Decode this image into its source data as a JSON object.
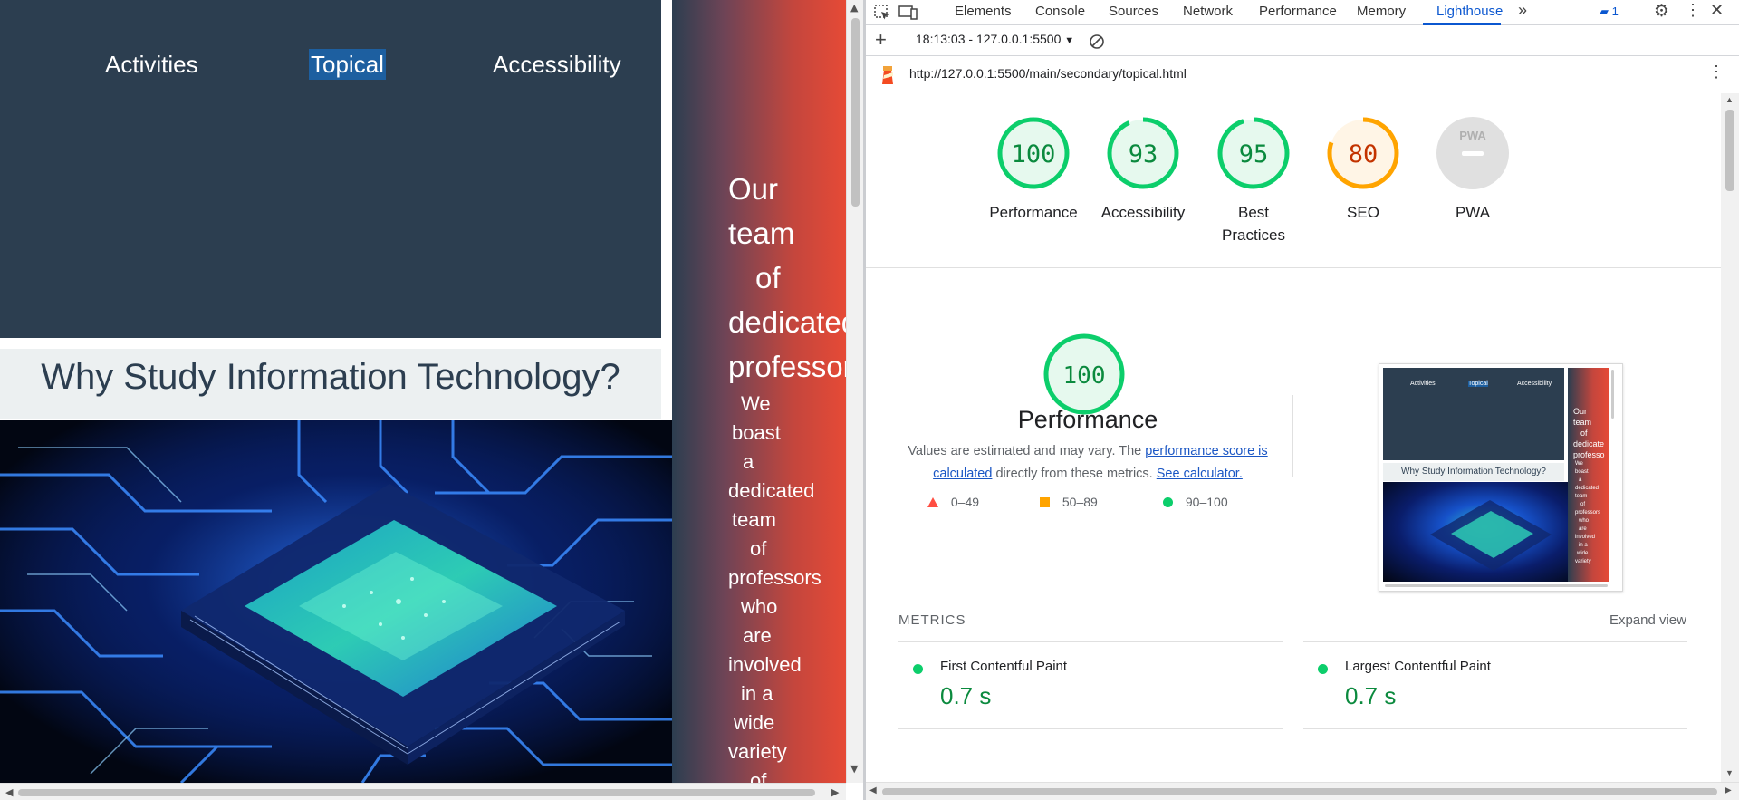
{
  "webpage": {
    "nav": {
      "activities": "Activities",
      "topical": "Topical",
      "accessibility": "Accessibility"
    },
    "heading": "Why Study Information Technology?",
    "side_big_words": [
      "Our",
      "team",
      "of",
      "dedicated",
      "professors"
    ],
    "side_small_words": [
      "We",
      "boast",
      "a",
      "dedicated",
      "team",
      "of",
      "professors",
      "who",
      "are",
      "involved",
      "in a",
      "wide",
      "variety",
      "of"
    ]
  },
  "devtools": {
    "tabs": [
      "Elements",
      "Console",
      "Sources",
      "Network",
      "Performance",
      "Memory",
      "Lighthouse"
    ],
    "active_tab": "Lighthouse",
    "issues_count": "1",
    "toolbar": {
      "add_label": "+",
      "report_select": "18:13:03 - 127.0.0.1:5500"
    },
    "url": "http://127.0.0.1:5500/main/secondary/topical.html",
    "colors": {
      "pass": "#0cce6b",
      "pass_text": "#0b8a3e",
      "average": "#ffa400",
      "average_text": "#c33300",
      "fail": "#ff4e42",
      "accent": "#0b57d0"
    },
    "gauges": [
      {
        "label": "Performance",
        "score": "100",
        "value": 100,
        "status": "pass"
      },
      {
        "label": "Accessibility",
        "score": "93",
        "value": 93,
        "status": "pass"
      },
      {
        "label": "Best Practices",
        "score": "95",
        "value": 95,
        "status": "pass"
      },
      {
        "label": "SEO",
        "score": "80",
        "value": 80,
        "status": "average"
      },
      {
        "label": "PWA",
        "badge": "PWA",
        "status": "na"
      }
    ],
    "performance": {
      "score": "100",
      "title": "Performance",
      "desc_before": "Values are estimated and may vary. The ",
      "desc_link": "performance score is calculated",
      "desc_middle": " directly from these metrics. ",
      "desc_link2": "See calculator.",
      "legend": [
        "0–49",
        "50–89",
        "90–100"
      ]
    },
    "thumbnail": {
      "nav": [
        "Activities",
        "Topical",
        "Accessibility"
      ],
      "heading": "Why Study Information Technology?",
      "big_words": [
        "Our",
        "team",
        "of",
        "dedicate",
        "professo"
      ],
      "small_words": [
        "We",
        "boast",
        "a",
        "dedicated",
        "team",
        "of",
        "professors",
        "who",
        "are",
        "involved",
        "in a",
        "wide",
        "variety"
      ]
    },
    "metrics": {
      "label": "METRICS",
      "expand": "Expand view",
      "items": [
        {
          "name": "First Contentful Paint",
          "value": "0.7 s"
        },
        {
          "name": "Largest Contentful Paint",
          "value": "0.7 s"
        }
      ]
    }
  }
}
